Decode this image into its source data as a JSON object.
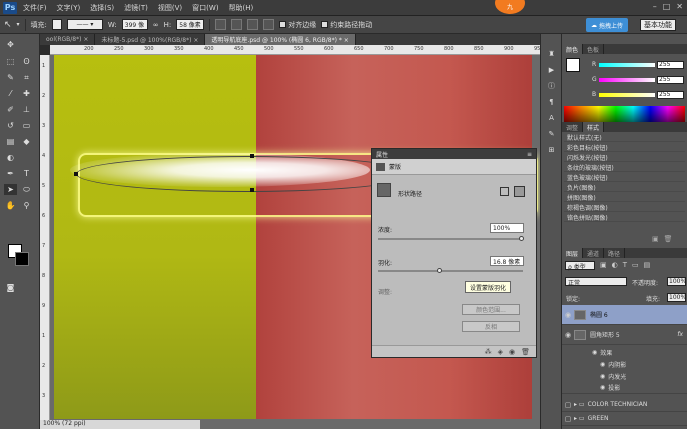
{
  "app": {
    "logo": "Ps",
    "menu": [
      "文件(F)",
      "文字(Y)",
      "选择(S)",
      "滤镜(T)",
      "视图(V)",
      "窗口(W)",
      "帮助(H)"
    ],
    "badge": "九"
  },
  "options_bar": {
    "fill_label": "填充:",
    "width_label": "W:",
    "width_value": "399 像",
    "height_label": "H:",
    "height_value": "58 像素",
    "align_edges": "对齐边缘",
    "constrain_path": "约束路径拖动",
    "upload_label": "拖拽上传",
    "workspace_label": "基本功能"
  },
  "doc_tabs": [
    {
      "label": "ool(RGB/8*) ×",
      "active": false
    },
    {
      "label": "未标题-5.psd @ 100%(RGB/8*) ×",
      "active": false
    },
    {
      "label": "透明导航底座.psd @ 100% (椭圆 6, RGB/8*) * ×",
      "active": true
    }
  ],
  "ruler_top": [
    "200",
    "250",
    "300",
    "350",
    "400",
    "450",
    "500",
    "550",
    "600",
    "650",
    "700",
    "750",
    "800",
    "850",
    "900",
    "950",
    "1000"
  ],
  "ruler_left": [
    "1",
    "2",
    "3",
    "4",
    "5",
    "6",
    "7",
    "8",
    "9",
    "1",
    "2",
    "3"
  ],
  "status": {
    "zoom": "100% (72 ppi)"
  },
  "properties": {
    "title": "属性",
    "section": "蒙版",
    "shape_label": "形状路径",
    "density_label": "浓度:",
    "density_value": "100%",
    "feather_label": "羽化:",
    "feather_value": "16.8 像素",
    "refine_label": "调整:",
    "btn_mask_edge": "蒙版边缘...",
    "btn_color_range": "颜色范围...",
    "btn_invert": "反相",
    "tooltip": "设置蒙版羽化"
  },
  "color_panel": {
    "tabs": [
      "颜色",
      "色板"
    ],
    "r": {
      "label": "R",
      "value": "255"
    },
    "g": {
      "label": "G",
      "value": "255"
    },
    "b": {
      "label": "B",
      "value": "255"
    }
  },
  "styles_panel": {
    "tabs": [
      "调整",
      "样式"
    ],
    "items": [
      "默认样式(无)",
      "彩色目标(按钮)",
      "闪烁发光(按钮)",
      "条纹的玻璃(按钮)",
      "蓝色玻璃(按钮)",
      "负片(图像)",
      "拼图(图像)",
      "棕褐色调(图像)",
      "铬色拼贴(图像)"
    ]
  },
  "layers_panel": {
    "tabs": [
      "图层",
      "通道",
      "路径"
    ],
    "filter_kind": "ρ 类型",
    "blend_mode": "正常",
    "opacity_label": "不透明度:",
    "opacity_value": "100%",
    "lock_label": "锁定:",
    "fill_label": "填充:",
    "fill_value": "100%",
    "layers": [
      {
        "name": "椭圆 6",
        "selected": true
      },
      {
        "name": "圆角矩形 5",
        "selected": false,
        "fx": "fx"
      },
      {
        "name": "效果",
        "selected": false
      },
      {
        "name": "内阴影",
        "selected": false
      },
      {
        "name": "内发光",
        "selected": false
      },
      {
        "name": "投影",
        "selected": false
      },
      {
        "name": "COLOR TECHNICIAN",
        "selected": false
      },
      {
        "name": "GREEN",
        "selected": false
      }
    ]
  },
  "colors": {
    "yellow": "#b7bf0f",
    "red": "#c4584f",
    "selected_layer": "#8ea0c8",
    "accent": "#3e8fd6"
  }
}
